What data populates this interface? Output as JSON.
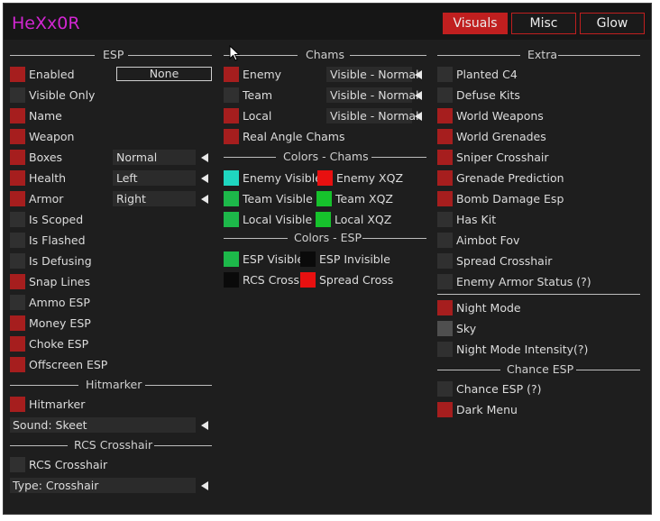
{
  "app": {
    "title": "HeXx0R"
  },
  "tabs": [
    {
      "label": "Visuals",
      "active": true
    },
    {
      "label": "Misc",
      "active": false
    },
    {
      "label": "Glow",
      "active": false
    }
  ],
  "colors": {
    "accent": "#c01f1f",
    "checkbox_on": "#a61e1e",
    "checkbox_off": "#303030",
    "title": "#d226d2"
  },
  "esp": {
    "header": "ESP",
    "none_button": "None",
    "items": [
      {
        "label": "Enabled",
        "checked": true
      },
      {
        "label": "Visible Only",
        "checked": false
      },
      {
        "label": "Name",
        "checked": true
      },
      {
        "label": "Weapon",
        "checked": true
      },
      {
        "label": "Boxes",
        "checked": true,
        "select": "Normal"
      },
      {
        "label": "Health",
        "checked": true,
        "select": "Left"
      },
      {
        "label": "Armor",
        "checked": true,
        "select": "Right"
      },
      {
        "label": "Is Scoped",
        "checked": false
      },
      {
        "label": "Is Flashed",
        "checked": false
      },
      {
        "label": "Is Defusing",
        "checked": false
      },
      {
        "label": "Snap Lines",
        "checked": true
      },
      {
        "label": "Ammo ESP",
        "checked": false
      },
      {
        "label": "Money ESP",
        "checked": true
      },
      {
        "label": "Choke ESP",
        "checked": true
      },
      {
        "label": "Offscreen ESP",
        "checked": true
      }
    ],
    "hitmarker_header": "Hitmarker",
    "hitmarker": {
      "label": "Hitmarker",
      "checked": true
    },
    "sound_select": "Sound: Skeet",
    "rcs_header": "RCS Crosshair",
    "rcs": {
      "label": "RCS Crosshair",
      "checked": false
    },
    "type_select": "Type: Crosshair"
  },
  "chams": {
    "header": "Chams",
    "items": [
      {
        "label": "Enemy",
        "checked": true,
        "select": "Visible - Normal"
      },
      {
        "label": "Team",
        "checked": false,
        "select": "Visible - Normal"
      },
      {
        "label": "Local",
        "checked": true,
        "select": "Visible - Normal"
      },
      {
        "label": "Real Angle Chams",
        "checked": true
      }
    ],
    "colors_header": "Colors - Chams",
    "colors": [
      {
        "label": "Enemy Visible",
        "color": "#1fd6c0"
      },
      {
        "label": "Enemy XQZ",
        "color": "#e81010"
      },
      {
        "label": "Team Visible",
        "color": "#1db84a"
      },
      {
        "label": "Team XQZ",
        "color": "#16c22c"
      },
      {
        "label": "Local Visible",
        "color": "#1db84a"
      },
      {
        "label": "Local XQZ",
        "color": "#16c22c"
      }
    ],
    "esp_colors_header": "Colors - ESP",
    "esp_colors": [
      {
        "label": "ESP Visible",
        "color": "#1db84a"
      },
      {
        "label": "ESP Invisible",
        "color": "#0a0a0a"
      },
      {
        "label": "RCS Cross",
        "color": "#0a0a0a"
      },
      {
        "label": "Spread Cross",
        "color": "#e81010"
      }
    ]
  },
  "extra": {
    "header": "Extra",
    "items": [
      {
        "label": "Planted C4",
        "checked": false
      },
      {
        "label": "Defuse Kits",
        "checked": false
      },
      {
        "label": "World Weapons",
        "checked": true
      },
      {
        "label": "World Grenades",
        "checked": true
      },
      {
        "label": "Sniper Crosshair",
        "checked": true
      },
      {
        "label": "Grenade Prediction",
        "checked": true
      },
      {
        "label": "Bomb Damage Esp",
        "checked": true
      },
      {
        "label": "Has Kit",
        "checked": false
      },
      {
        "label": "Aimbot Fov",
        "checked": false
      },
      {
        "label": "Spread Crosshair",
        "checked": false
      },
      {
        "label": "Enemy Armor Status (?)",
        "checked": false
      }
    ],
    "world_items": [
      {
        "label": "Night Mode",
        "checked": true
      },
      {
        "label": "Sky",
        "checked": false,
        "gray": true
      },
      {
        "label": "Night Mode Intensity(?)",
        "checked": false
      }
    ],
    "chance_header": "Chance ESP",
    "chance_items": [
      {
        "label": "Chance ESP (?)",
        "checked": false
      },
      {
        "label": "Dark Menu",
        "checked": true
      }
    ]
  }
}
